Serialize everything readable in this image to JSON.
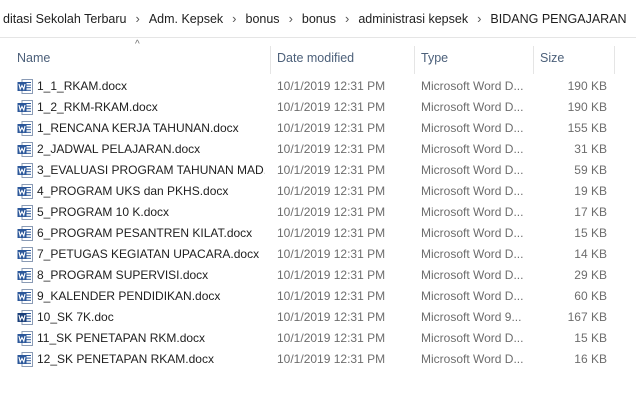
{
  "breadcrumb": {
    "items": [
      "ditasi Sekolah Terbaru",
      "Adm. Kepsek",
      "bonus",
      "bonus",
      "administrasi kepsek",
      "BIDANG PENGAJARAN"
    ],
    "separator": "›"
  },
  "columns": {
    "name": "Name",
    "date": "Date modified",
    "type": "Type",
    "size": "Size",
    "sort_indicator": "^"
  },
  "files": [
    {
      "name": "1_1_RKAM.docx",
      "date": "10/1/2019 12:31 PM",
      "type": "Microsoft Word D...",
      "size": "190 KB",
      "icon": "word-docx-icon"
    },
    {
      "name": "1_2_RKM-RKAM.docx",
      "date": "10/1/2019 12:31 PM",
      "type": "Microsoft Word D...",
      "size": "190 KB",
      "icon": "word-docx-icon"
    },
    {
      "name": "1_RENCANA  KERJA TAHUNAN.docx",
      "date": "10/1/2019 12:31 PM",
      "type": "Microsoft Word D...",
      "size": "155 KB",
      "icon": "word-docx-icon"
    },
    {
      "name": "2_JADWAL PELAJARAN.docx",
      "date": "10/1/2019 12:31 PM",
      "type": "Microsoft Word D...",
      "size": "31 KB",
      "icon": "word-docx-icon"
    },
    {
      "name": "3_EVALUASI PROGRAM TAHUNAN MAD...",
      "date": "10/1/2019 12:31 PM",
      "type": "Microsoft Word D...",
      "size": "59 KB",
      "icon": "word-docx-icon"
    },
    {
      "name": "4_PROGRAM UKS dan PKHS.docx",
      "date": "10/1/2019 12:31 PM",
      "type": "Microsoft Word D...",
      "size": "19 KB",
      "icon": "word-docx-icon"
    },
    {
      "name": "5_PROGRAM 10 K.docx",
      "date": "10/1/2019 12:31 PM",
      "type": "Microsoft Word D...",
      "size": "17 KB",
      "icon": "word-docx-icon"
    },
    {
      "name": "6_PROGRAM PESANTREN KILAT.docx",
      "date": "10/1/2019 12:31 PM",
      "type": "Microsoft Word D...",
      "size": "15 KB",
      "icon": "word-docx-icon"
    },
    {
      "name": "7_PETUGAS KEGIATAN UPACARA.docx",
      "date": "10/1/2019 12:31 PM",
      "type": "Microsoft Word D...",
      "size": "14 KB",
      "icon": "word-docx-icon"
    },
    {
      "name": "8_PROGRAM SUPERVISI.docx",
      "date": "10/1/2019 12:31 PM",
      "type": "Microsoft Word D...",
      "size": "29 KB",
      "icon": "word-docx-icon"
    },
    {
      "name": "9_KALENDER PENDIDIKAN.docx",
      "date": "10/1/2019 12:31 PM",
      "type": "Microsoft Word D...",
      "size": "60 KB",
      "icon": "word-docx-icon"
    },
    {
      "name": "10_SK 7K.doc",
      "date": "10/1/2019 12:31 PM",
      "type": "Microsoft Word 9...",
      "size": "167 KB",
      "icon": "word-doc-icon"
    },
    {
      "name": "11_SK PENETAPAN  RKM.docx",
      "date": "10/1/2019 12:31 PM",
      "type": "Microsoft Word D...",
      "size": "15 KB",
      "icon": "word-docx-icon"
    },
    {
      "name": "12_SK PENETAPAN RKAM.docx",
      "date": "10/1/2019 12:31 PM",
      "type": "Microsoft Word D...",
      "size": "16 KB",
      "icon": "word-docx-icon"
    }
  ],
  "colors": {
    "header_text": "#4c607a",
    "word_blue": "#2b579a",
    "word_blue_dark": "#1a3f7a",
    "secondary_text": "#6d6d6d"
  }
}
